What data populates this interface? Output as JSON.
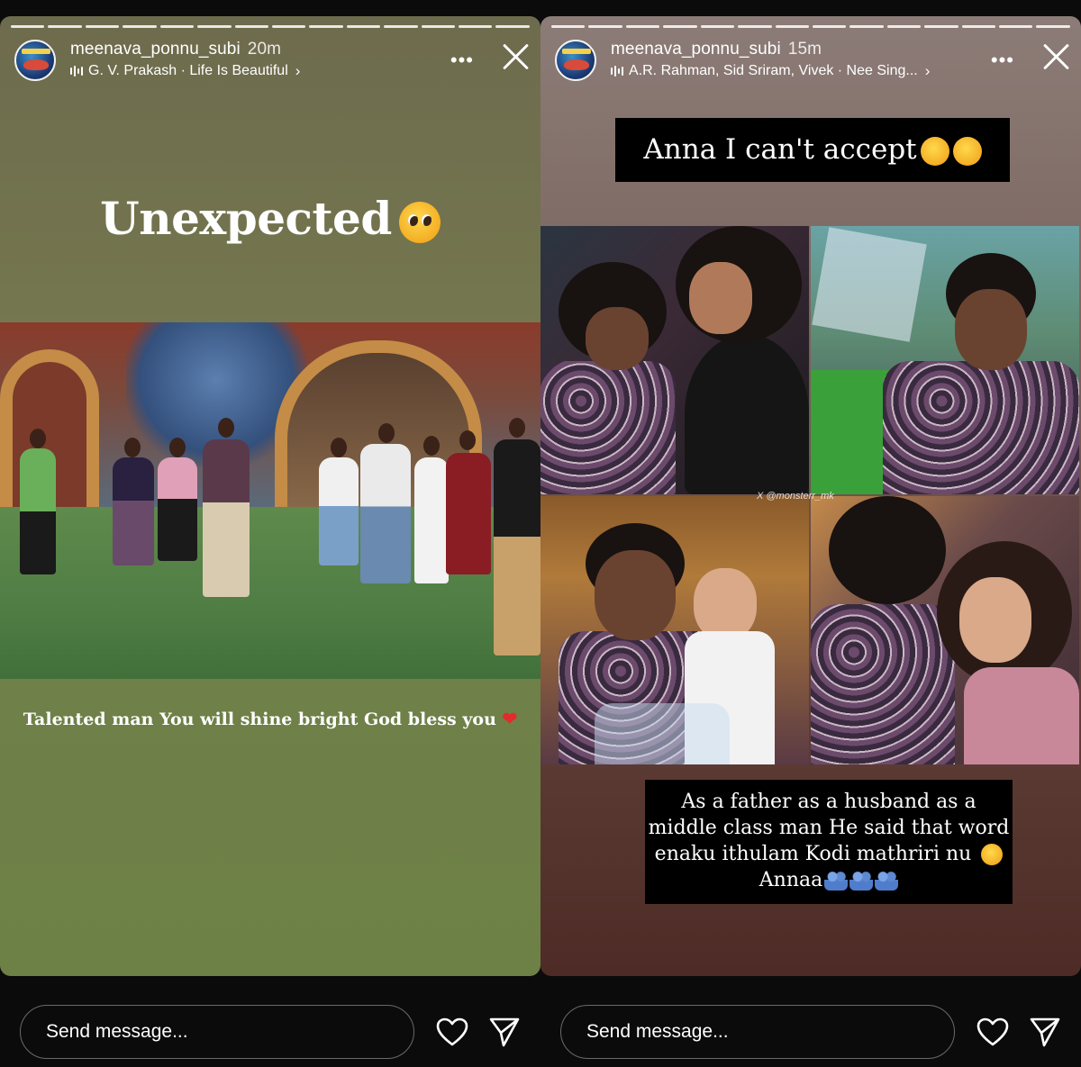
{
  "left": {
    "username": "meenava_ponnu_subi",
    "time": "20m",
    "music": "G. V. Prakash · Life Is Beautiful",
    "headline": "Unexpected",
    "caption": "Talented man You will shine bright God bless you",
    "send_placeholder": "Send message..."
  },
  "right": {
    "username": "meenava_ponnu_subi",
    "time": "15m",
    "music": "A.R. Rahman, Sid Sriram, Vivek · Nee Sing...",
    "top_label": "Anna I can't accept",
    "bottom_line1": "As a father as a husband as a",
    "bottom_line2": "middle class man He said that word",
    "bottom_line3": "enaku ithulam Kodi mathriri nu",
    "bottom_line4": "Annaa",
    "watermark": "X @monsterr_mk",
    "send_placeholder": "Send message..."
  },
  "icons": {
    "more": "more-options-icon",
    "close": "close-icon",
    "like": "heart-icon",
    "share": "send-icon",
    "music": "music-bars-icon"
  },
  "colors": {
    "left_bg": "#737a4f",
    "right_bg": "#6e5049",
    "text": "#ffffff"
  }
}
